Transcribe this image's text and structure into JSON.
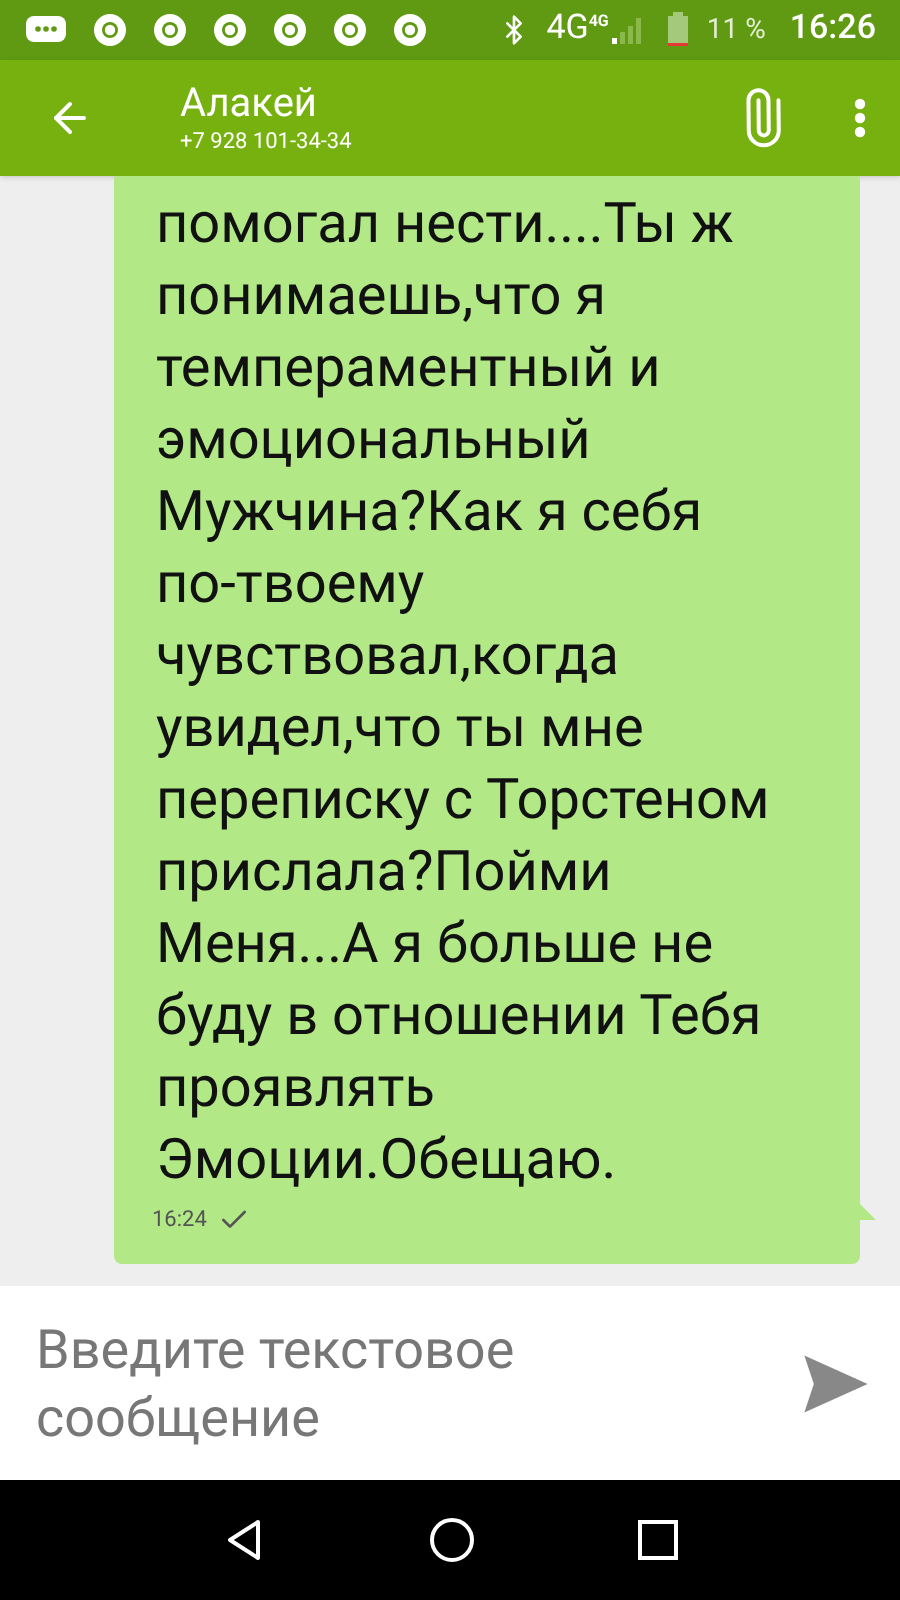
{
  "status_bar": {
    "network": "4G",
    "network_small": "4G",
    "battery": "11 %",
    "time": "16:26"
  },
  "header": {
    "contact_name": "Алакей",
    "phone": "+7 928 101-34-34"
  },
  "messages": [
    {
      "text": "помогал нести....Ты ж понимаешь,что я темпераментный и эмоциональный Мужчина?Как я себя по-твоему чувствовал,когда увидел,что ты мне переписку с Торстеном прислала?Пойми Меня...А я больше не буду в отношении Тебя проявлять Эмоции.Обещаю.",
      "time": "16:24",
      "delivered": true
    }
  ],
  "composer": {
    "placeholder": "Введите текстовое сообщение"
  }
}
